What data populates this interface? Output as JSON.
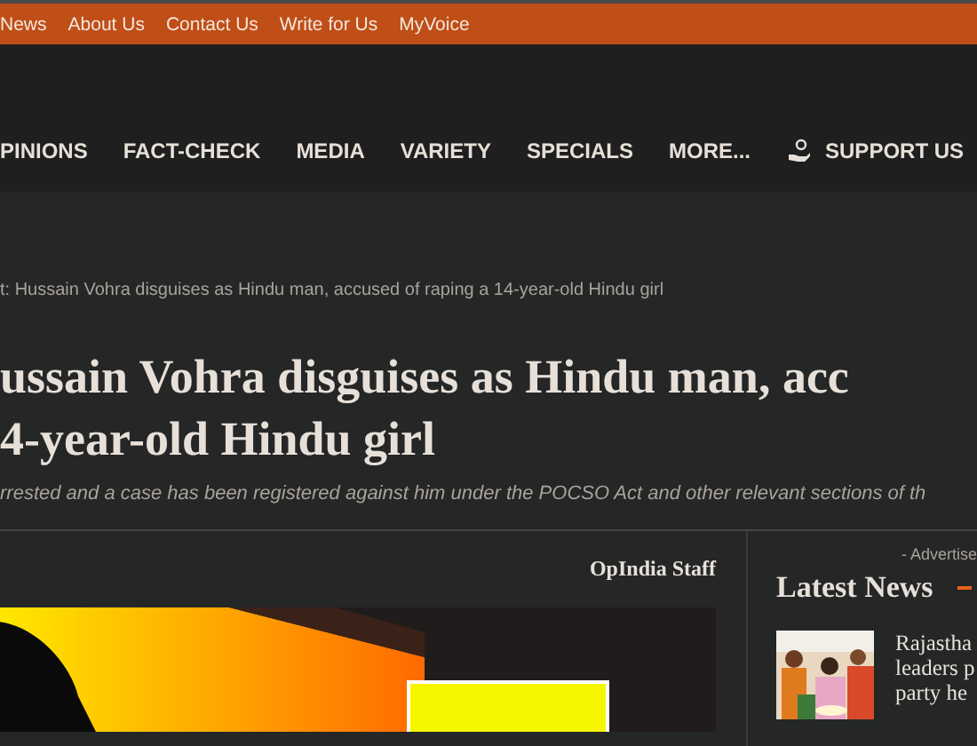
{
  "top_bar": {
    "links": [
      "News",
      "About Us",
      "Contact Us",
      "Write for Us",
      "MyVoice"
    ]
  },
  "nav": {
    "items": [
      {
        "label": "PINIONS",
        "kind": "link"
      },
      {
        "label": "FACT-CHECK",
        "kind": "link"
      },
      {
        "label": "MEDIA",
        "kind": "link"
      },
      {
        "label": "VARIETY",
        "kind": "link"
      },
      {
        "label": "SPECIALS",
        "kind": "link"
      },
      {
        "label": "MORE...",
        "kind": "link"
      },
      {
        "label": "SUPPORT US",
        "kind": "support"
      }
    ]
  },
  "article": {
    "breadcrumb": "t: Hussain Vohra disguises as Hindu man, accused of raping a 14-year-old Hindu girl",
    "title_lines": [
      "ussain Vohra disguises as Hindu man, acc",
      "4-year-old Hindu girl"
    ],
    "subtitle": "rrested and a case has been registered against him under the POCSO Act and other relevant sections of th",
    "author": "OpIndia Staff",
    "image": {
      "kind": "picture"
    }
  },
  "sidebar": {
    "ad_label": "- Advertise",
    "heading": "Latest News",
    "news": [
      {
        "lines": [
          "Rajastha",
          "leaders p",
          "party he"
        ],
        "image": {
          "kind": "picture"
        }
      }
    ]
  }
}
